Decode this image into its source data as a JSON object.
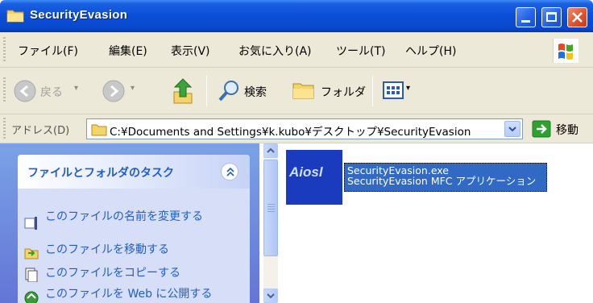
{
  "window": {
    "title": "SecurityEvasion"
  },
  "menu": {
    "items": [
      "ファイル(F)",
      "編集(E)",
      "表示(V)",
      "お気に入り(A)",
      "ツール(T)",
      "ヘルプ(H)"
    ]
  },
  "toolbar": {
    "back_label": "戻る",
    "search_label": "検索",
    "folders_label": "フォルダ"
  },
  "address": {
    "label": "アドレス(D)",
    "path": "C:¥Documents and Settings¥k.kubo¥デスクトップ¥SecurityEvasion",
    "go_label": "移動"
  },
  "tasks": {
    "title": "ファイルとフォルダのタスク",
    "items": [
      "このファイルの名前を変更する",
      "このファイルを移動する",
      "このファイルをコピーする",
      "このファイルを Web に公開する"
    ]
  },
  "file": {
    "icon_text": "Aiosl",
    "name": "SecurityEvasion.exe",
    "description": "SecurityEvasion MFC アプリケーション"
  },
  "colors": {
    "title_bar": "#0a4fd8",
    "selection": "#316ac5",
    "task_link": "#215dc6"
  }
}
